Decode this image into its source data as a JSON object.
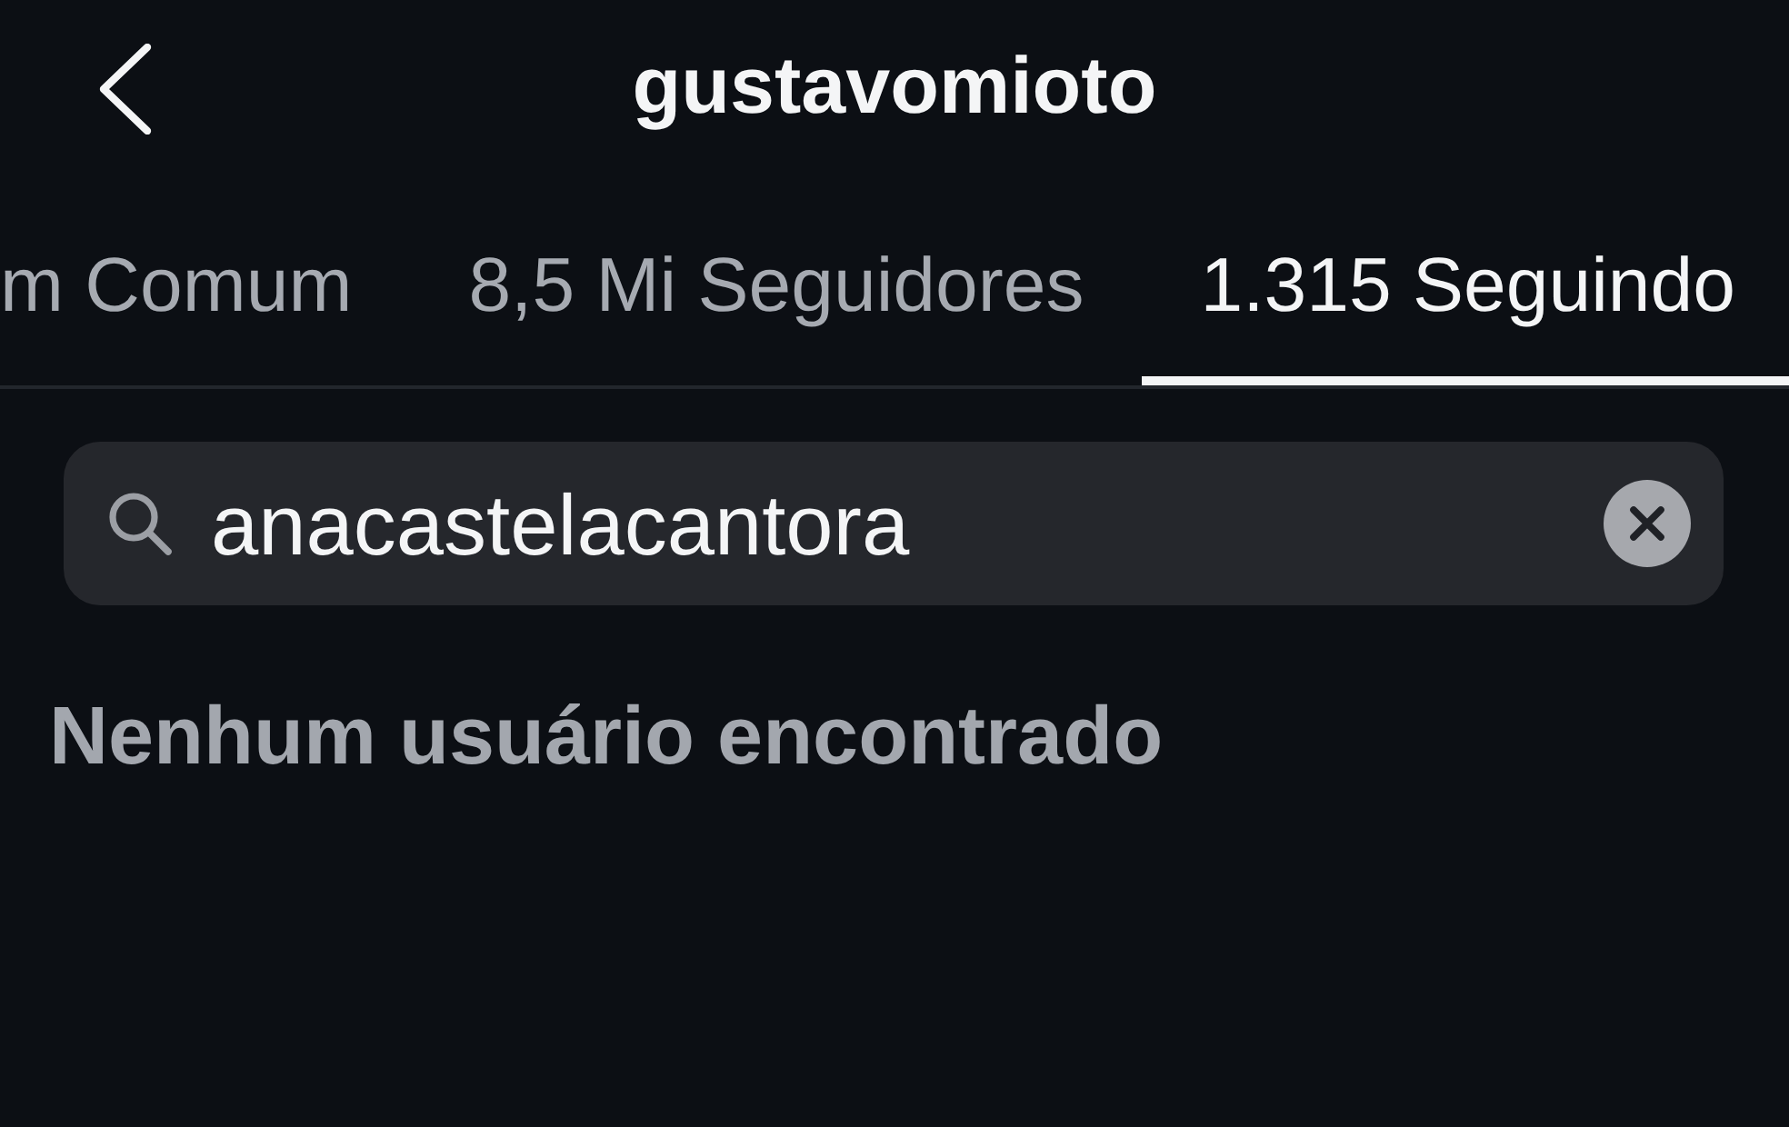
{
  "header": {
    "title": "gustavomioto"
  },
  "tabs": [
    {
      "label": "m Comum",
      "selected": false
    },
    {
      "label": "8,5 Mi Seguidores",
      "selected": false
    },
    {
      "label": "1.315 Seguindo",
      "selected": true
    }
  ],
  "search": {
    "value": "anacastelacantora"
  },
  "message": "Nenhum usuário encontrado"
}
